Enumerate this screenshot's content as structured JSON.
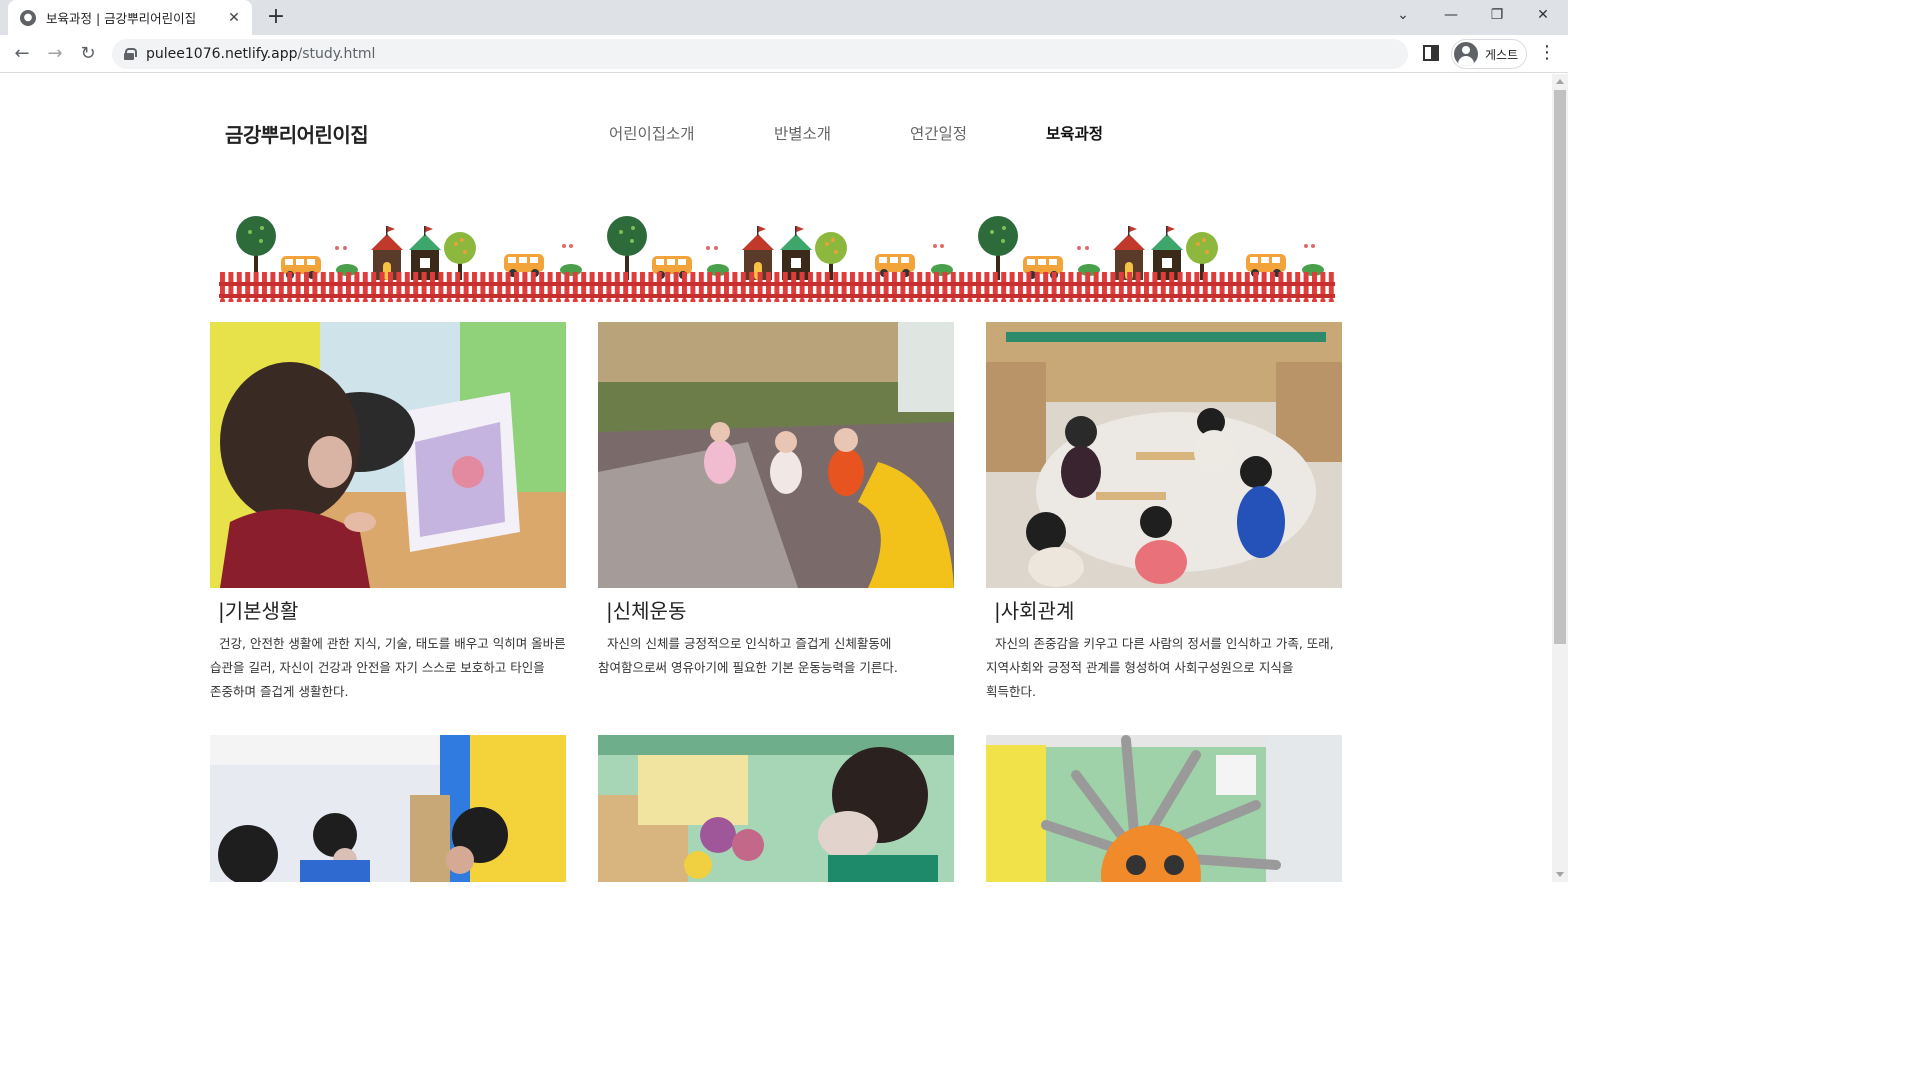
{
  "browser": {
    "tab_title": "보육과정 | 금강뿌리어린이집",
    "url_host": "pulee1076.netlify.app",
    "url_path": "/study.html",
    "profile_label": "게스트"
  },
  "site": {
    "logo": "금강뿌리어린이집",
    "nav": [
      "어린이집소개",
      "반별소개",
      "연간일정",
      "보육과정"
    ],
    "active_nav": "보육과정"
  },
  "cards": [
    {
      "title": "|기본생활",
      "text": "건강, 안전한 생활에 관한 지식, 기술, 태도를 배우고 익히며 올바른 습관을 길러, 자신이 건강과 안전을 자기 스스로 보호하고 타인을 존중하며 즐겁게 생활한다."
    },
    {
      "title": "|신체운동",
      "text": "자신의 신체를 긍정적으로 인식하고 즐겁게 신체활동에 참여함으로써 영유아기에 필요한 기본 운동능력을 기른다."
    },
    {
      "title": "|사회관계",
      "text": "자신의 존중감을 키우고 다른 사람의 정서를 인식하고 가족, 또래, 지역사회와 긍정적 관계를 형성하여 사회구성원으로 지식을 획득한다."
    }
  ],
  "colors": {
    "fence": "#e03c3c",
    "tree": "#2e6b3a",
    "bus": "#f2a33a",
    "roof": "#c0392b"
  }
}
